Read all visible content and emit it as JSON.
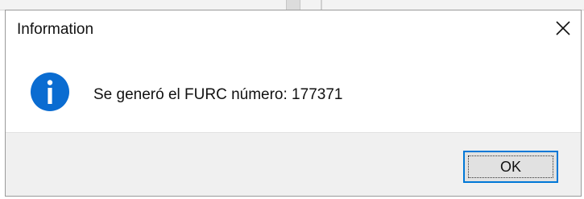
{
  "dialog": {
    "title": "Information",
    "close_icon": "close-icon",
    "icon": "information-icon",
    "message": "Se generó el FURC número: 177371",
    "ok_label": "OK",
    "accent_color": "#0078d7",
    "icon_color": "#0a6cd1"
  }
}
